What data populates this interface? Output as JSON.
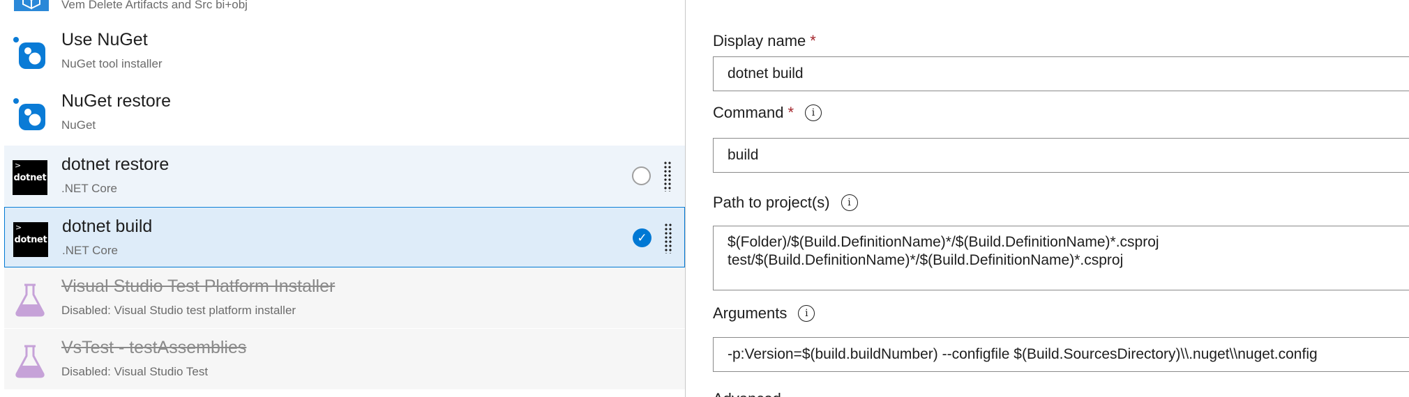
{
  "tasks": [
    {
      "name": "Vem Delete Artifacts and Src bi+obj",
      "subtitle": "",
      "icon": "vem-cube-icon",
      "state": "normal"
    },
    {
      "name": "Use NuGet",
      "subtitle": "NuGet tool installer",
      "icon": "nuget-icon",
      "state": "normal"
    },
    {
      "name": "NuGet restore",
      "subtitle": "NuGet",
      "icon": "nuget-icon",
      "state": "normal"
    },
    {
      "name": "dotnet restore",
      "subtitle": ".NET Core",
      "icon": "dotnet-icon",
      "state": "hover"
    },
    {
      "name": "dotnet build",
      "subtitle": ".NET Core",
      "icon": "dotnet-icon",
      "state": "selected"
    },
    {
      "name": "Visual Studio Test Platform Installer",
      "subtitle": "Disabled: Visual Studio test platform installer",
      "icon": "flask-icon",
      "state": "disabled"
    },
    {
      "name": "VsTest - testAssemblies",
      "subtitle": "Disabled: Visual Studio Test",
      "icon": "flask-icon",
      "state": "disabled"
    }
  ],
  "dotnet_icon_text": "dotnet",
  "detail": {
    "display_name": {
      "label": "Display name",
      "required_mark": "*",
      "value": "dotnet build"
    },
    "command": {
      "label": "Command",
      "required_mark": "*",
      "value": "build"
    },
    "path": {
      "label": "Path to project(s)",
      "lines": [
        "$(Folder)/$(Build.DefinitionName)*/$(Build.DefinitionName)*.csproj",
        "test/$(Build.DefinitionName)*/$(Build.DefinitionName)*.csproj"
      ]
    },
    "arguments": {
      "label": "Arguments",
      "value": "-p:Version=$(build.buildNumber) --configfile $(Build.SourcesDirectory)\\\\.nuget\\\\nuget.config"
    },
    "advanced_label": "Advanced"
  },
  "colors": {
    "accent": "#0078d4",
    "selected_bg": "#deecf9",
    "hover_bg": "#eef4fa",
    "required": "#a4262c",
    "nuget_blue": "#0a7bd6",
    "flask_purple": "#c6a2d8"
  }
}
